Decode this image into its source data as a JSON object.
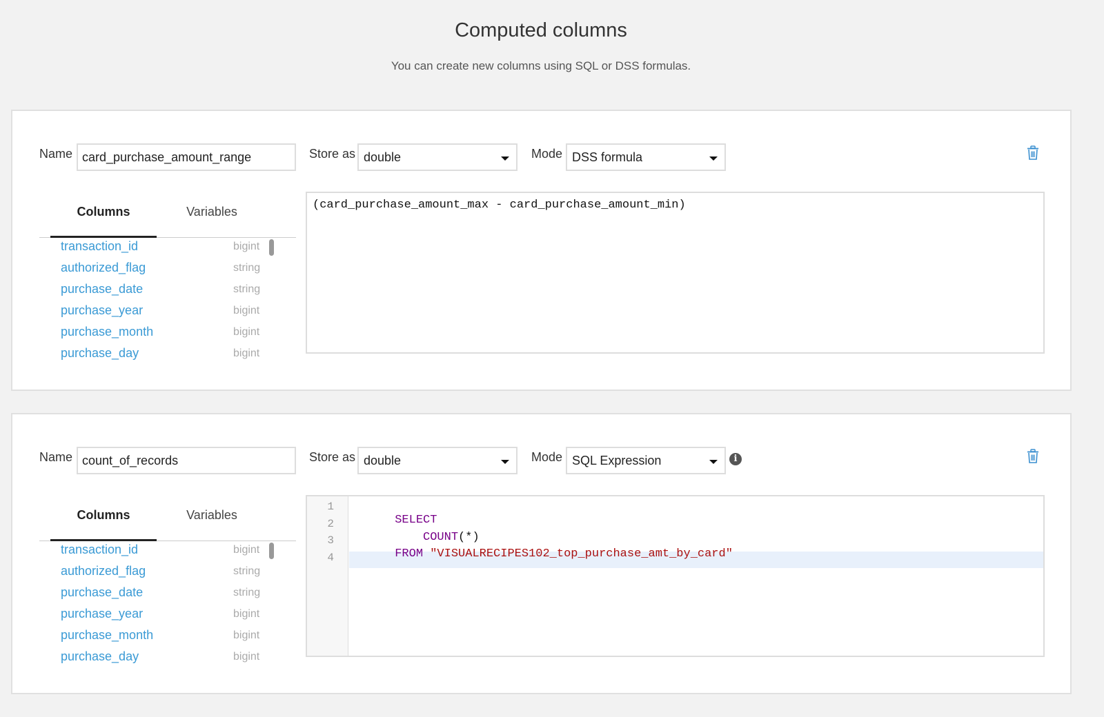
{
  "header": {
    "title": "Computed columns",
    "subtitle": "You can create new columns using SQL or DSS formulas."
  },
  "labels": {
    "name": "Name",
    "store_as": "Store as",
    "mode": "Mode",
    "tab_columns": "Columns",
    "tab_variables": "Variables"
  },
  "columns": [
    {
      "name": "transaction_id",
      "type": "bigint"
    },
    {
      "name": "authorized_flag",
      "type": "string"
    },
    {
      "name": "purchase_date",
      "type": "string"
    },
    {
      "name": "purchase_year",
      "type": "bigint"
    },
    {
      "name": "purchase_month",
      "type": "bigint"
    },
    {
      "name": "purchase_day",
      "type": "bigint"
    }
  ],
  "computed": [
    {
      "name": "card_purchase_amount_range",
      "store_as": "double",
      "mode": "DSS formula",
      "formula": "(card_purchase_amount_max - card_purchase_amount_min)"
    },
    {
      "name": "count_of_records",
      "store_as": "double",
      "mode": "SQL Expression",
      "code_lines": [
        {
          "num": "1",
          "kw": "SELECT",
          "rest": "",
          "str": ""
        },
        {
          "num": "2",
          "kw": "    COUNT",
          "rest": "(*)",
          "str": ""
        },
        {
          "num": "3",
          "kw": "FROM",
          "rest": " ",
          "str": "\"VISUALRECIPES102_top_purchase_amt_by_card\""
        },
        {
          "num": "4",
          "kw": "",
          "rest": "",
          "str": ""
        }
      ]
    }
  ],
  "icons": {
    "delete": "trash-icon",
    "info": "info-icon",
    "dropdown": "caret-down-icon"
  },
  "colors": {
    "link": "#3a9ad5",
    "trash": "#3a8fd0",
    "keyword": "#770088",
    "string": "#aa1111"
  }
}
